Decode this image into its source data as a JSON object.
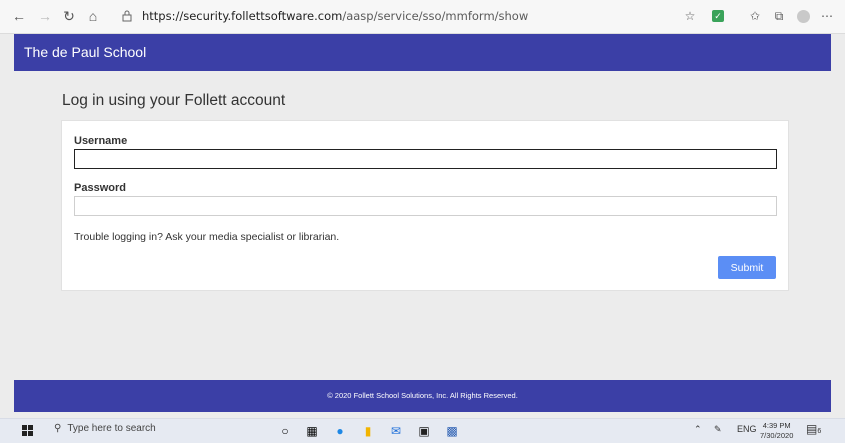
{
  "browser": {
    "url_host": "https://security.follettsoftware.com",
    "url_path": "/aasp/service/sso/mmform/show"
  },
  "header": {
    "school_name": "The de Paul School"
  },
  "login": {
    "title": "Log in using your Follett account",
    "username_label": "Username",
    "username_value": "",
    "password_label": "Password",
    "password_value": "",
    "help_text": "Trouble logging in? Ask your media specialist or librarian.",
    "submit_label": "Submit"
  },
  "footer": {
    "copyright": "© 2020 Follett School Solutions, Inc. All Rights Reserved."
  },
  "taskbar": {
    "search_placeholder": "Type here to search",
    "language": "ENG",
    "time": "4:39 PM",
    "date": "7/30/2020",
    "notification_count": "6"
  },
  "icons": [
    "back-icon",
    "forward-icon",
    "refresh-icon",
    "home-icon",
    "lock-icon",
    "favorite-star-icon",
    "extension-icon",
    "favorites-bar-icon",
    "collections-icon",
    "profile-icon",
    "more-icon"
  ]
}
